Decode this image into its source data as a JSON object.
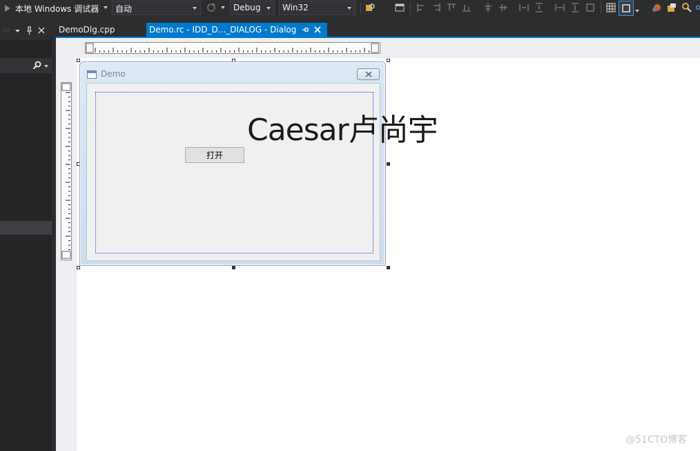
{
  "toolbar": {
    "debugger_label": "本地 Windows 调试器",
    "solution_config_combo": "自动",
    "configuration": "Debug",
    "platform": "Win32"
  },
  "tabs": {
    "inactive": "DemoDlg.cpp",
    "active": "Demo.rc - IDD_D..._DIALOG - Dialog"
  },
  "dialog": {
    "title": "Demo",
    "button_label": "打开"
  },
  "canvas": {
    "caption": "Caesar卢尚宇",
    "watermark": "@51CTO博客"
  },
  "colors": {
    "accent": "#007acc",
    "ide_background": "#2d2d30",
    "designer_background": "#ffffff"
  }
}
